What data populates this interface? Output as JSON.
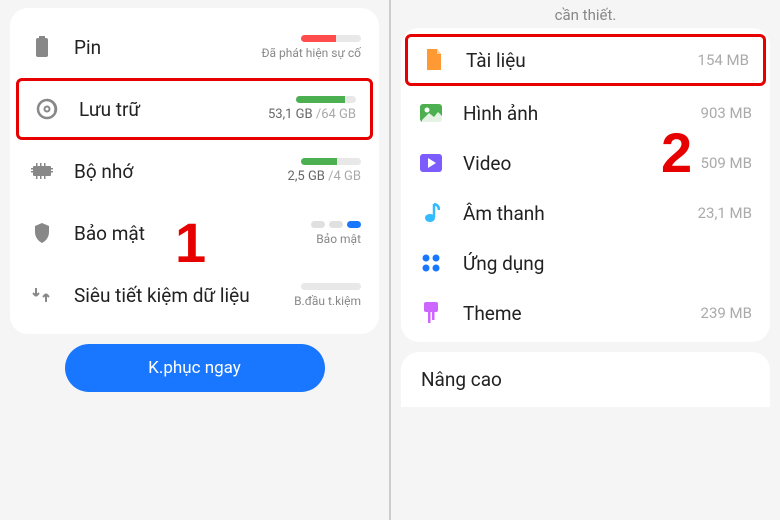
{
  "left": {
    "cutText": "",
    "rows": [
      {
        "id": "battery",
        "label": "Pin",
        "status": "Đã phát hiện sự cố",
        "barColor": "bar-red",
        "barWidth": "58%"
      },
      {
        "id": "storage",
        "label": "Lưu trữ",
        "used": "53,1 GB",
        "total": "/64 GB",
        "barColor": "bar-green",
        "barWidth": "82%",
        "highlight": true
      },
      {
        "id": "memory",
        "label": "Bộ nhớ",
        "used": "2,5 GB",
        "total": "/4 GB",
        "barColor": "bar-green",
        "barWidth": "60%"
      },
      {
        "id": "security",
        "label": "Bảo mật",
        "status": "Bảo mật",
        "dots": true
      },
      {
        "id": "datasaver",
        "label": "Siêu tiết kiệm dữ liệu",
        "status": "B.đầu t.kiệm",
        "barColor": "bar-gray",
        "barWidth": "0%"
      }
    ],
    "button": "K.phục ngay",
    "annotation": "1"
  },
  "right": {
    "cutText": "cần thiết.",
    "categories": [
      {
        "id": "documents",
        "label": "Tài liệu",
        "value": "154 MB",
        "color": "#ff9933",
        "highlight": true
      },
      {
        "id": "images",
        "label": "Hình ảnh",
        "value": "903 MB",
        "color": "#4caf50"
      },
      {
        "id": "video",
        "label": "Video",
        "value": "509 MB",
        "color": "#7c5cff"
      },
      {
        "id": "audio",
        "label": "Âm thanh",
        "value": "23,1 MB",
        "color": "#33bbff"
      },
      {
        "id": "apps",
        "label": "Ứng dụng",
        "value": "",
        "color": "#1976ff"
      },
      {
        "id": "theme",
        "label": "Theme",
        "value": "239 MB",
        "color": "#cc66ff"
      }
    ],
    "section": "Nâng cao",
    "annotation": "2"
  }
}
